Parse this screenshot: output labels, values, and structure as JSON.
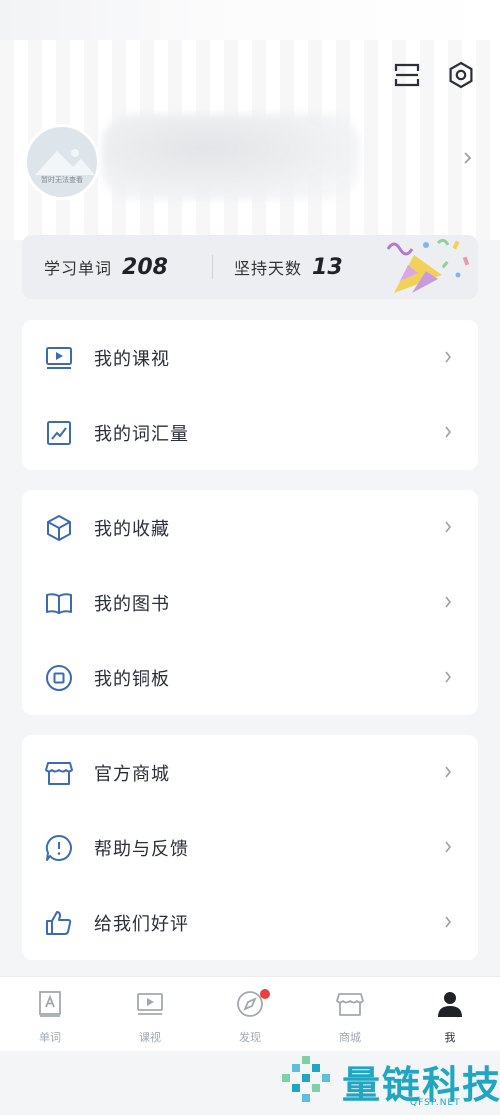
{
  "header": {
    "avatar_placeholder": "暂时无法查看",
    "icons": [
      "scan-icon",
      "settings-icon"
    ]
  },
  "stats": {
    "words_label": "学习单词",
    "words_value": "208",
    "days_label": "坚持天数",
    "days_value": "13"
  },
  "menu": {
    "group1": [
      {
        "label": "我的课视",
        "icon": "video-icon"
      },
      {
        "label": "我的词汇量",
        "icon": "chart-icon"
      }
    ],
    "group2": [
      {
        "label": "我的收藏",
        "icon": "cube-icon"
      },
      {
        "label": "我的图书",
        "icon": "book-icon"
      },
      {
        "label": "我的铜板",
        "icon": "coin-icon"
      }
    ],
    "group3": [
      {
        "label": "官方商城",
        "icon": "store-icon"
      },
      {
        "label": "帮助与反馈",
        "icon": "feedback-icon"
      },
      {
        "label": "给我们好评",
        "icon": "thumbs-up-icon"
      }
    ]
  },
  "tabbar": {
    "tabs": [
      {
        "label": "单词",
        "icon": "word-icon"
      },
      {
        "label": "课视",
        "icon": "video-icon"
      },
      {
        "label": "发现",
        "icon": "compass-icon"
      },
      {
        "label": "商城",
        "icon": "store-icon"
      },
      {
        "label": "我",
        "icon": "profile-icon"
      }
    ],
    "active_index": 4
  },
  "watermark": {
    "text": "量链科技",
    "sub": "QFSP.NET"
  },
  "colors": {
    "icon_blue": "#3d6bb3",
    "accent_red": "#e8403b",
    "watermark": "#1ea6c2"
  }
}
